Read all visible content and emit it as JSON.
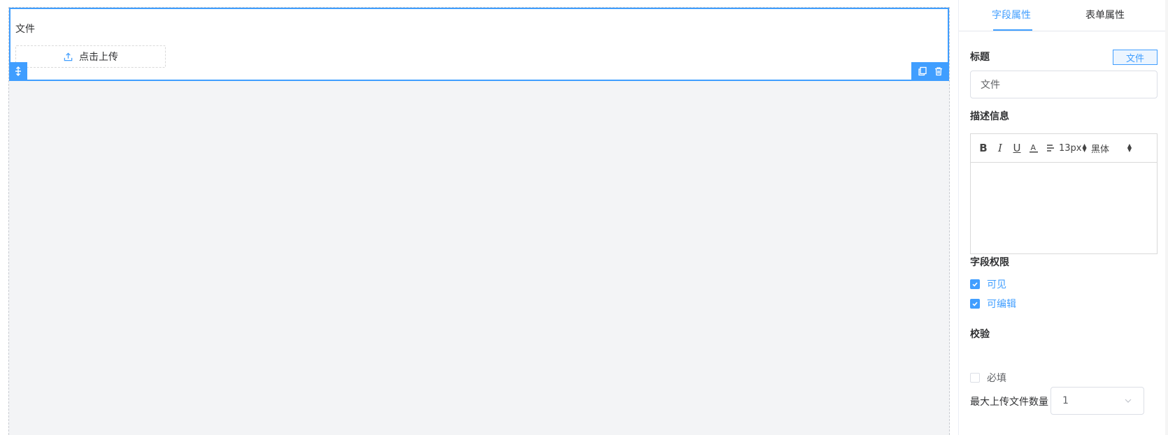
{
  "canvas": {
    "field": {
      "title": "文件",
      "upload_label": "点击上传"
    }
  },
  "panel": {
    "tabs": [
      {
        "label": "字段属性",
        "active": true
      },
      {
        "label": "表单属性",
        "active": false
      }
    ],
    "title_section": {
      "label": "标题",
      "tag": "文件",
      "input_value": "文件"
    },
    "desc_section": {
      "label": "描述信息",
      "toolbar": {
        "bold": "B",
        "italic": "I",
        "underline": "U",
        "color": "A",
        "font_size": "13px",
        "font_family": "黑体"
      }
    },
    "permission_section": {
      "label": "字段权限",
      "options": [
        {
          "label": "可见",
          "checked": true
        },
        {
          "label": "可编辑",
          "checked": true
        }
      ]
    },
    "validation_section": {
      "label": "校验",
      "required": {
        "label": "必填",
        "checked": false
      },
      "max_files_label": "最大上传文件数量",
      "max_files_value": "1"
    }
  },
  "colors": {
    "accent": "#409eff",
    "canvas_bg": "#f3f4f6"
  }
}
